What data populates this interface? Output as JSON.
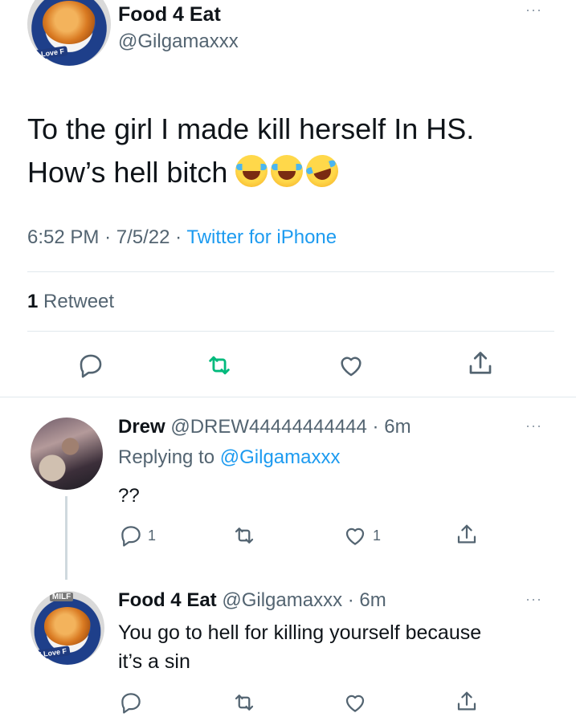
{
  "main_tweet": {
    "author_name": "Food 4 Eat",
    "handle": "@Gilgamaxxx",
    "avatar_tag": "I Love F",
    "text_line1": "To the girl I made kill herself In HS.",
    "text_line2": "How’s hell bitch",
    "emojis": [
      "face-with-tears-of-joy",
      "face-with-tears-of-joy",
      "rolling-on-the-floor-laughing"
    ],
    "time": "6:52 PM",
    "date": "7/5/22",
    "source": "Twitter for iPhone",
    "retweet_count": "1",
    "retweet_label": "Retweet",
    "more": "···"
  },
  "reply1": {
    "author_name": "Drew",
    "handle": "@DREW44444444444",
    "age": "6m",
    "replying_prefix": "Replying to",
    "replying_handle": "@Gilgamaxxx",
    "text": "??",
    "reply_count": "1",
    "like_count": "1",
    "more": "···"
  },
  "reply2": {
    "author_name": "Food 4 Eat",
    "handle": "@Gilgamaxxx",
    "age": "6m",
    "avatar_badge": "MILF",
    "avatar_tag": "I Love F",
    "text_line1": "You go to hell for killing yourself because",
    "text_line2": "it’s a sin",
    "more": "···"
  },
  "colors": {
    "retweet_active": "#00ba7c",
    "link": "#1d9bf0",
    "secondary_text": "#536471"
  }
}
